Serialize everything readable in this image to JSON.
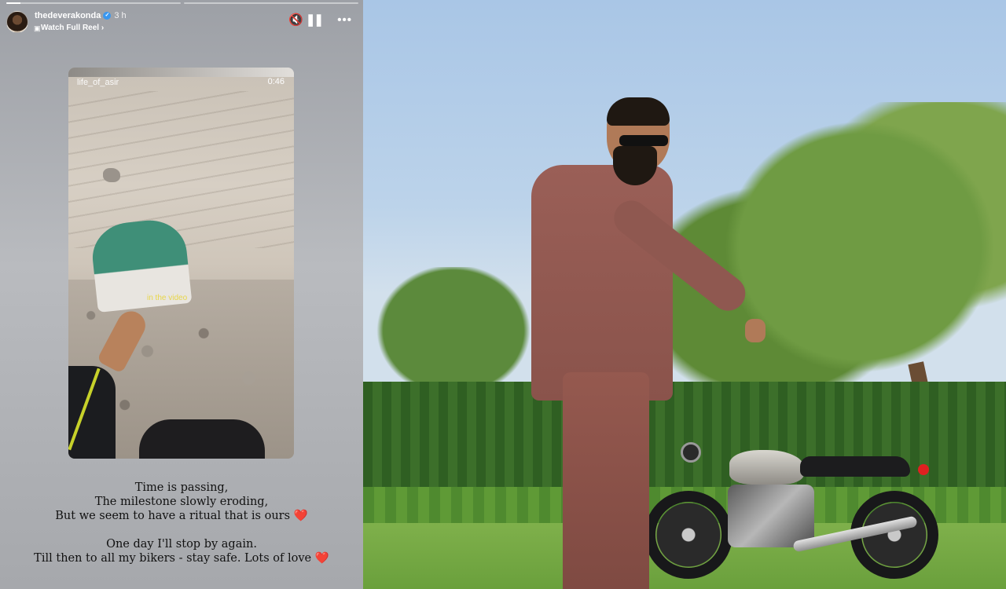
{
  "story": {
    "progress": [
      {
        "fill": 0.08
      },
      {
        "fill": 0
      }
    ],
    "header": {
      "username": "thedeverakonda",
      "time": "3 h",
      "watch_label": "Watch Full Reel",
      "chevron": "›",
      "mute_icon": "🔇",
      "pause_icon": "❚❚",
      "more_icon": "•••"
    },
    "reel": {
      "user": "life_of_asir",
      "duration": "0:46",
      "overlay_text": "in the video"
    },
    "caption": {
      "line1": "Time is passing,",
      "line2": "The milestone slowly eroding,",
      "line3": "But we seem to have a ritual that is ours",
      "line4": "One day I'll stop by again.",
      "line5": "Till then to all my bikers - stay safe. Lots of love",
      "heart": "❤️"
    }
  },
  "colors": {
    "heart": "#e0241f",
    "verified": "#3897f0",
    "sky": "#a9c6e6"
  }
}
